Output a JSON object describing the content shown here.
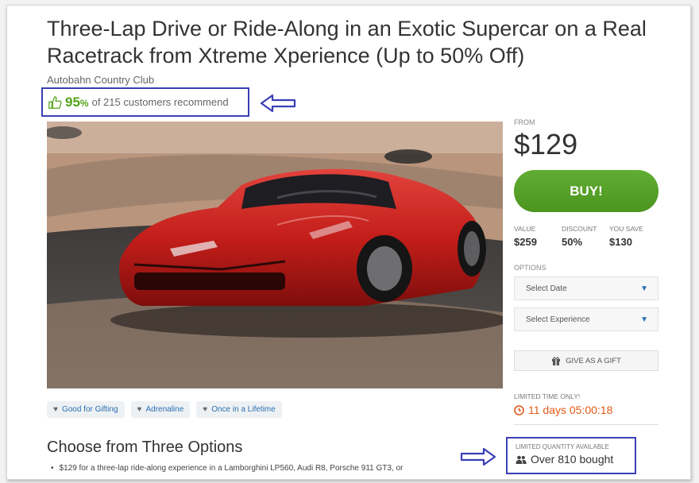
{
  "deal": {
    "title": "Three-Lap Drive or Ride-Along in an Exotic Supercar on a Real Racetrack from Xtreme Xperience (Up to 50% Off)",
    "merchant": "Autobahn Country Club",
    "recommend_pct": "95",
    "recommend_pct_sign": "%",
    "recommend_text": "of 215 customers recommend"
  },
  "hero_image": {
    "icon": "red-ferrari-sports-car-photo"
  },
  "tags": [
    {
      "label": "Good for Gifting"
    },
    {
      "label": "Adrenaline"
    },
    {
      "label": "Once in a Lifetime"
    }
  ],
  "options_section": {
    "heading": "Choose from Three Options",
    "bullet_1": "$129 for a three-lap ride-along experience in a Lamborghini LP560, Audi R8, Porsche 911 GT3, or"
  },
  "sidebar": {
    "from_label": "FROM",
    "price": "$129",
    "buy_label": "BUY!",
    "stats": [
      {
        "label": "VALUE",
        "value": "$259"
      },
      {
        "label": "DISCOUNT",
        "value": "50%"
      },
      {
        "label": "YOU SAVE",
        "value": "$130"
      }
    ],
    "options_label": "OPTIONS",
    "select_date": "Select Date",
    "select_experience": "Select Experience",
    "gift_label": "GIVE AS A GIFT",
    "limited_time_label": "LIMITED TIME ONLY!",
    "timer": "11 days 05:00:18",
    "limited_qty_label": "LIMITED QUANTITY AVAILABLE",
    "bought": "Over 810 bought"
  },
  "colors": {
    "accent_green": "#53a318",
    "buy_green": "#4c951f",
    "link_blue": "#2b6fb0",
    "timer_orange": "#e05a18",
    "annotation_blue": "#3a3fb5"
  }
}
